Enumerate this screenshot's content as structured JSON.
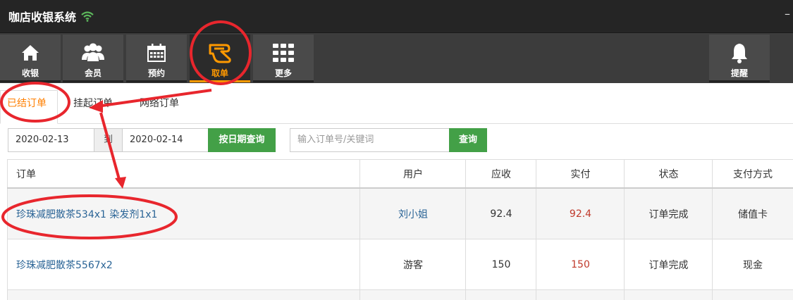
{
  "window": {
    "title": "咖店收银系统",
    "minimize_symbol": "–"
  },
  "toolbar": {
    "items": [
      {
        "label": "收银",
        "icon": "home-icon"
      },
      {
        "label": "会员",
        "icon": "members-icon"
      },
      {
        "label": "预约",
        "icon": "calendar-icon"
      },
      {
        "label": "取单",
        "icon": "take-order-icon",
        "active": true
      },
      {
        "label": "更多",
        "icon": "grid-icon"
      },
      {
        "label": "提醒",
        "icon": "bell-icon"
      }
    ],
    "accent": "#ff9900"
  },
  "tabs": [
    {
      "label": "已结订单",
      "active": true
    },
    {
      "label": "挂起订单"
    },
    {
      "label": "网络订单"
    }
  ],
  "search": {
    "date_from": "2020-02-13",
    "date_to_label": "到",
    "date_to": "2020-02-14",
    "date_query_button": "按日期查询",
    "keyword_placeholder": "输入订单号/关键词",
    "query_button": "查询"
  },
  "table": {
    "columns": [
      "订单",
      "用户",
      "应收",
      "实付",
      "状态",
      "支付方式"
    ],
    "rows": [
      {
        "order": "珍珠减肥散茶534x1 染发剂1x1",
        "user": "刘小姐",
        "receivable": "92.4",
        "paid": "92.4",
        "status": "订单完成",
        "payment": "储值卡"
      },
      {
        "order": "珍珠减肥散茶5567x2",
        "user": "游客",
        "receivable": "150",
        "paid": "150",
        "status": "订单完成",
        "payment": "现金"
      }
    ]
  },
  "colors": {
    "annotation": "#e8262d",
    "green": "#43a047",
    "link": "#2a6496"
  }
}
